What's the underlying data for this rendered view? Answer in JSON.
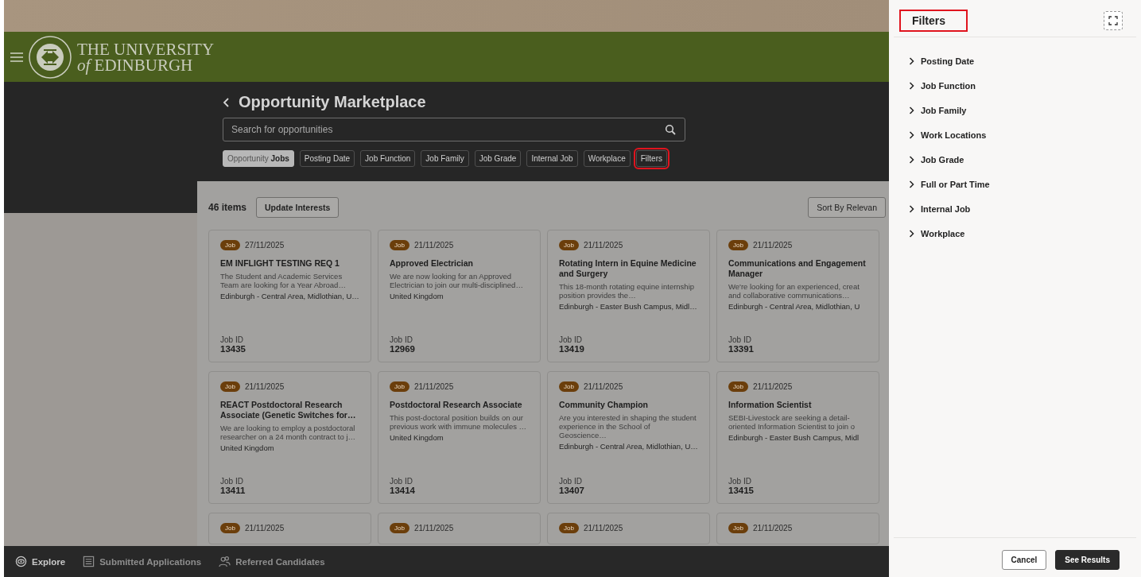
{
  "header": {
    "logo_line1": "THE UNIVERSITY",
    "logo_line2": "*of* EDINBURGH"
  },
  "page_title": "Opportunity Marketplace",
  "search": {
    "placeholder": "Search for opportunities"
  },
  "chips": [
    {
      "label": "Opportunity **Jobs**",
      "selected": true,
      "highlighted": false
    },
    {
      "label": "Posting Date",
      "selected": false,
      "highlighted": false
    },
    {
      "label": "Job Function",
      "selected": false,
      "highlighted": false
    },
    {
      "label": "Job Family",
      "selected": false,
      "highlighted": false
    },
    {
      "label": "Job Grade",
      "selected": false,
      "highlighted": false
    },
    {
      "label": "Internal Job",
      "selected": false,
      "highlighted": false
    },
    {
      "label": "Workplace",
      "selected": false,
      "highlighted": false
    },
    {
      "label": "Filters",
      "selected": false,
      "highlighted": true
    }
  ],
  "results": {
    "count": "46 items",
    "update_button": "Update Interests",
    "sort_button": "Sort By Relevan"
  },
  "cards": [
    {
      "badge": "Job",
      "date": "27/11/2025",
      "title": "EM INFLIGHT TESTING REQ 1",
      "description": "The Student and Academic Services Team are looking for a Year Abroad…",
      "location": "Edinburgh - Central Area, Midlothian, U…",
      "id_label": "Job ID",
      "id": "13435"
    },
    {
      "badge": "Job",
      "date": "21/11/2025",
      "title": "Approved Electrician",
      "description": "We are now looking for an Approved Electrician to join our multi-disciplined…",
      "location": "United Kingdom",
      "id_label": "Job ID",
      "id": "12969"
    },
    {
      "badge": "Job",
      "date": "21/11/2025",
      "title": "Rotating Intern in Equine Medicine and Surgery",
      "description": "This 18-month rotating equine internship position provides the…",
      "location": "Edinburgh - Easter Bush Campus, Midl…",
      "id_label": "Job ID",
      "id": "13419"
    },
    {
      "badge": "Job",
      "date": "21/11/2025",
      "title": "Communications and Engagement Manager",
      "description": "We're looking for an experienced, creat and collaborative communications…",
      "location": "Edinburgh - Central Area, Midlothian, U",
      "id_label": "Job ID",
      "id": "13391"
    },
    {
      "badge": "Job",
      "date": "21/11/2025",
      "title": "REACT Postdoctoral Research Associate (Genetic Switches for…",
      "description": "We are looking to employ a postdoctoral researcher on a 24 month contract to j…",
      "location": "United Kingdom",
      "id_label": "Job ID",
      "id": "13411"
    },
    {
      "badge": "Job",
      "date": "21/11/2025",
      "title": "Postdoctoral Research Associate",
      "description": "This post-doctoral position builds on our previous work with immune molecules …",
      "location": "United Kingdom",
      "id_label": "Job ID",
      "id": "13414"
    },
    {
      "badge": "Job",
      "date": "21/11/2025",
      "title": "Community Champion",
      "description": "Are you interested in shaping the student experience in the School of Geoscience…",
      "location": "Edinburgh - Central Area, Midlothian, U…",
      "id_label": "Job ID",
      "id": "13407"
    },
    {
      "badge": "Job",
      "date": "21/11/2025",
      "title": "Information Scientist",
      "description": "SEBI-Livestock are seeking a detail-oriented Information Scientist to join o",
      "location": "Edinburgh - Easter Bush Campus, Midl",
      "id_label": "Job ID",
      "id": "13415"
    },
    {
      "badge": "Job",
      "date": "21/11/2025"
    },
    {
      "badge": "Job",
      "date": "21/11/2025"
    },
    {
      "badge": "Job",
      "date": "21/11/2025"
    },
    {
      "badge": "Job",
      "date": "21/11/2025"
    }
  ],
  "bottom_nav": [
    {
      "label": "Explore",
      "kind": "eye",
      "selected": true
    },
    {
      "label": "Submitted Applications",
      "kind": "list",
      "selected": false
    },
    {
      "label": "Referred Candidates",
      "kind": "people",
      "selected": false
    }
  ],
  "filters_panel": {
    "title": "Filters",
    "title_highlighted": true,
    "items": [
      {
        "label": "Posting Date",
        "expanded": false
      },
      {
        "label": "Job Function",
        "expanded": false
      },
      {
        "label": "Job Family",
        "expanded": false
      },
      {
        "label": "Work Locations",
        "expanded": false
      },
      {
        "label": "Job Grade",
        "expanded": false
      },
      {
        "label": "Full or Part Time",
        "expanded": false
      },
      {
        "label": "Internal Job",
        "expanded": false
      },
      {
        "label": "Workplace",
        "expanded": false
      }
    ],
    "cancel_button": "Cancel",
    "results_button": "See Results"
  }
}
